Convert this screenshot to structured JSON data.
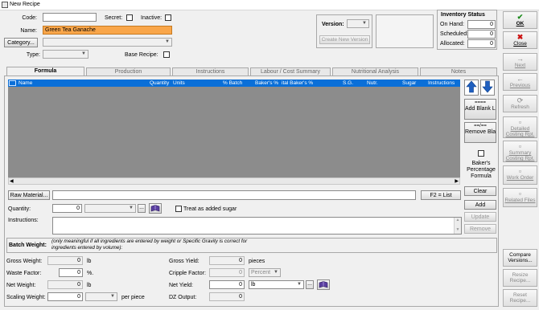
{
  "window": {
    "title": "New Recipe"
  },
  "fields": {
    "code_label": "Code:",
    "code_value": "",
    "secret_label": "Secret:",
    "inactive_label": "Inactive:",
    "name_label": "Name:",
    "name_value": "Green Tea Ganache",
    "category_button": "Category...",
    "type_label": "Type:",
    "base_recipe_label": "Base Recipe:",
    "version_label": "Version:",
    "create_version_button": "Create New Version"
  },
  "inventory": {
    "title": "Inventory Status",
    "on_hand_label": "On Hand:",
    "on_hand_value": "0",
    "scheduled_label": "Scheduled:",
    "scheduled_value": "0",
    "allocated_label": "Allocated:",
    "allocated_value": "0"
  },
  "tabs": [
    "Formula",
    "Production",
    "Instructions",
    "Labour / Cost Summary",
    "Nutritional Analysis",
    "Notes"
  ],
  "grid": {
    "columns": [
      "Name",
      "Quantity",
      "Units",
      "% Batch",
      "Baker's %",
      "ital Baker's %",
      "S.G.",
      "Nutr.",
      "Sugar",
      "Instructions"
    ]
  },
  "grid_side": {
    "add_blank_line": "Add Blank Line",
    "remove_blank_line": "Remove Blank Line",
    "bakers_percentage_formula": "Baker's Percentage Formula"
  },
  "entry": {
    "raw_material_button": "Raw Material...",
    "f2_list_button": "F2 = List",
    "clear_button": "Clear",
    "quantity_label": "Quantity:",
    "quantity_value": "0",
    "ellipsis": "...",
    "treat_as_sugar_label": "Treat as added sugar",
    "add_button": "Add",
    "instructions_label": "Instructions:",
    "update_button": "Update",
    "remove_button": "Remove"
  },
  "batch": {
    "title": "Batch Weight:",
    "note": "(only meaningful if all ingredients are entered by weight or Specific Gravity is correct for ingredients entered by volume):",
    "gross_weight_label": "Gross Weight:",
    "gross_weight_value": "0",
    "gross_weight_unit": "lb",
    "waste_factor_label": "Waste Factor:",
    "waste_factor_value": "0",
    "waste_factor_unit": "%.",
    "net_weight_label": "Net Weight:",
    "net_weight_value": "0",
    "net_weight_unit": "lb",
    "scaling_weight_label": "Scaling Weight:",
    "scaling_weight_value": "0",
    "scaling_weight_unit": "per piece",
    "gross_yield_label": "Gross Yield:",
    "gross_yield_value": "0",
    "gross_yield_unit": "pieces",
    "cripple_factor_label": "Cripple Factor:",
    "cripple_factor_value": "0",
    "cripple_factor_unit": "Percent",
    "net_yield_label": "Net Yield:",
    "net_yield_value": "0",
    "net_yield_unit": "lb",
    "dz_output_label": "DZ Output:",
    "dz_output_value": "0"
  },
  "sidebar": {
    "ok": "OK",
    "close": "Close",
    "next": "Next",
    "previous": "Previous",
    "refresh": "Refresh",
    "detailed_costing": "Detailed Costing Rpt.",
    "summary_costing": "Summary Costing Rpt.",
    "work_order": "Work Order",
    "related_files": "Related Files",
    "compare_versions": "Compare Versions...",
    "resize_recipe": "Resize Recipe...",
    "reset_recipe": "Reset Recipe..."
  },
  "colors": {
    "accent": "#0a6fd8",
    "highlight": "#f9a64a",
    "grid_bg": "#8c8c8c"
  },
  "icons": [
    "arrow-up-icon",
    "arrow-down-icon",
    "checkmark-icon",
    "close-x-icon",
    "book-icon"
  ]
}
